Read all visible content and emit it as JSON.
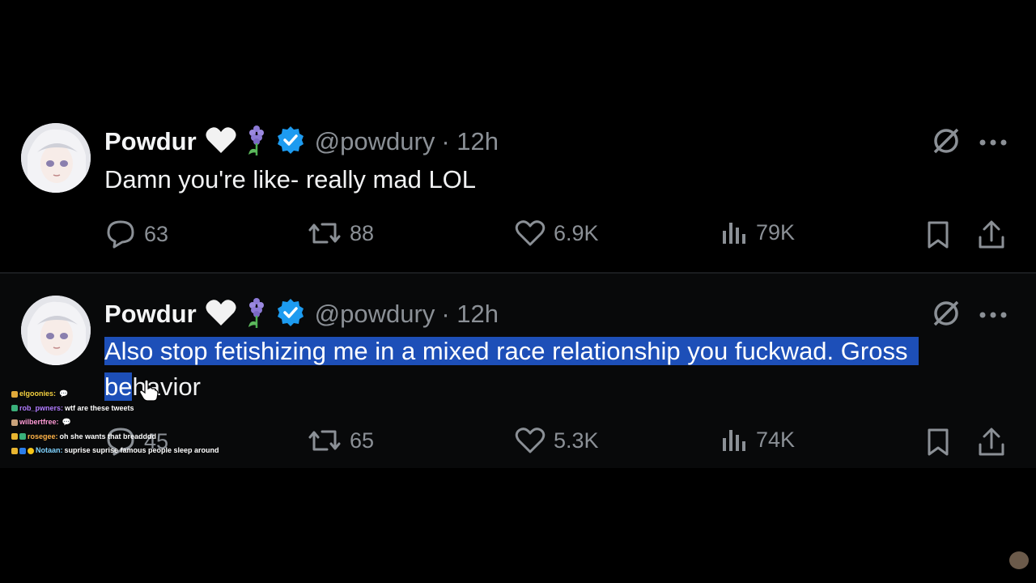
{
  "tweets": [
    {
      "name": "Powdur",
      "handle": "@powdury",
      "time": "· 12h",
      "text": "Damn you're like- really mad LOL",
      "replies": "63",
      "reposts": "88",
      "likes": "6.9K",
      "views": "79K"
    },
    {
      "name": "Powdur",
      "handle": "@powdury",
      "time": "· 12h",
      "text_line1": "Also stop fetishizing me in a mixed race relationship you fuckwad. Gross",
      "text_line2_a": "be",
      "text_line2_b": "havior",
      "replies": "45",
      "reposts": "65",
      "likes": "5.3K",
      "views": "74K"
    }
  ],
  "chat": [
    {
      "user": "elgoonies:",
      "message": ""
    },
    {
      "user": "rob_pwners:",
      "message": "wtf are these tweets"
    },
    {
      "user": "wilbertfree:",
      "message": ""
    },
    {
      "user": "rosegee:",
      "message": "oh she wants that breadddd"
    },
    {
      "user": "Notaan:",
      "message": "suprise suprise famous people sleep around"
    }
  ],
  "colors": {
    "background": "#000000",
    "verified": "#1d9bf0",
    "highlight": "#1d4fb8",
    "muted": "#8b9096"
  }
}
